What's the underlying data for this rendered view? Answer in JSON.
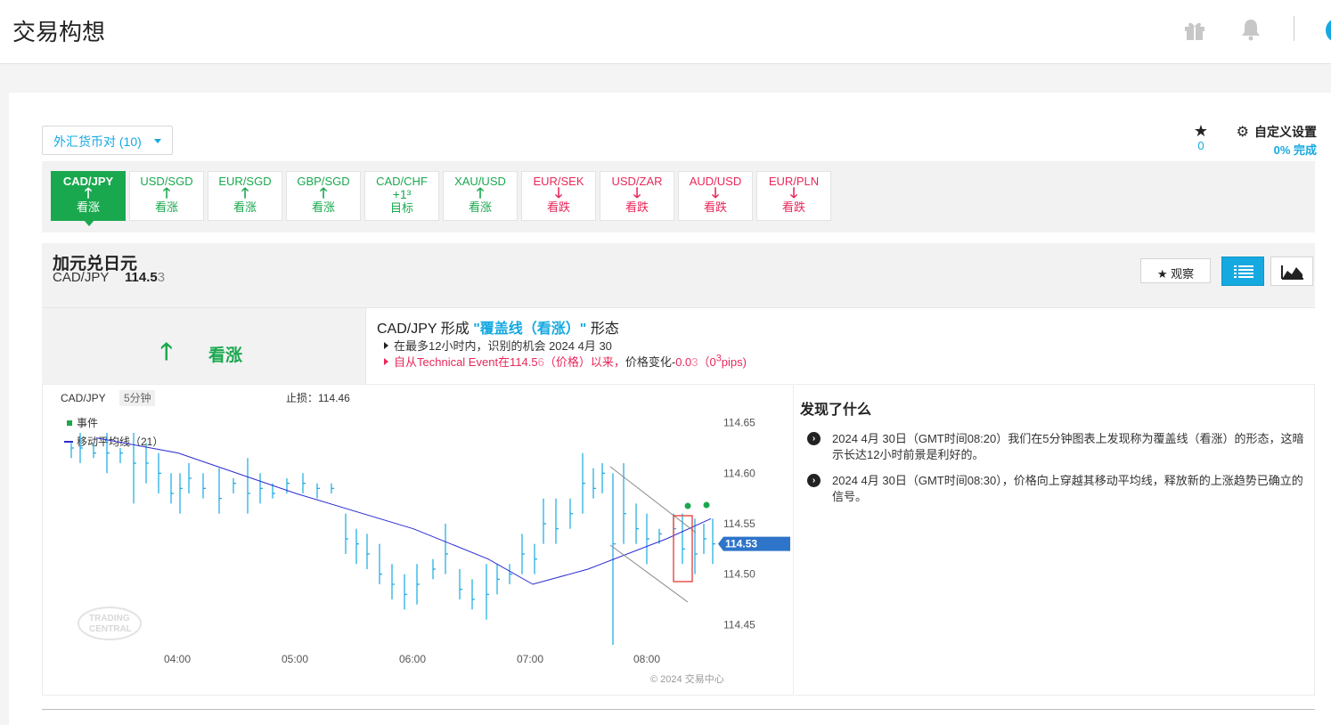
{
  "header": {
    "title": "交易构想"
  },
  "filter": {
    "dropdown_label": "外汇货币对 (10)"
  },
  "watchlist": {
    "count": "0"
  },
  "settings": {
    "label": "自定义设置",
    "progress": "0% 完成"
  },
  "tabs": [
    {
      "symbol": "CAD/JPY",
      "arrow": "🡑",
      "label": "看涨",
      "state": "active"
    },
    {
      "symbol": "USD/SGD",
      "arrow": "🡑",
      "label": "看涨",
      "state": "up"
    },
    {
      "symbol": "EUR/SGD",
      "arrow": "🡑",
      "label": "看涨",
      "state": "up"
    },
    {
      "symbol": "GBP/SGD",
      "arrow": "🡑",
      "label": "看涨",
      "state": "up"
    },
    {
      "symbol": "CAD/CHF",
      "arrow": "+1³",
      "label": "目标",
      "state": "neutral"
    },
    {
      "symbol": "XAU/USD",
      "arrow": "🡑",
      "label": "看涨",
      "state": "up"
    },
    {
      "symbol": "EUR/SEK",
      "arrow": "🡓",
      "label": "看跌",
      "state": "down"
    },
    {
      "symbol": "USD/ZAR",
      "arrow": "🡓",
      "label": "看跌",
      "state": "down"
    },
    {
      "symbol": "AUD/USD",
      "arrow": "🡓",
      "label": "看跌",
      "state": "down"
    },
    {
      "symbol": "EUR/PLN",
      "arrow": "🡓",
      "label": "看跌",
      "state": "down"
    }
  ],
  "instrument": {
    "name": "加元兑日元",
    "symbol": "CAD/JPY",
    "price_main": "114.5",
    "price_last": "3",
    "watch_button": "观察"
  },
  "verdict": {
    "label": "看涨"
  },
  "pattern": {
    "title_prefix": "CAD/JPY 形成 ",
    "title_highlight": "\"覆盖线（看涨）\"",
    "title_suffix": " 形态",
    "line1": "在最多12小时内，识别的机会 2024 4月 30",
    "line2_a": "自从Technical Event在114.5",
    "line2_b": "6",
    "line2_c": "（价格）以来，",
    "line2_d": "价格变化-",
    "line2_e": "0.0",
    "line2_f": "3",
    "line2_g": "（0",
    "line2_h": "3",
    "line2_i": "pips)"
  },
  "chart": {
    "symbol": "CAD/JPY",
    "timeframe": "5分钟",
    "stop_loss": "止损：114.46",
    "legend_event": "事件",
    "legend_ma": "移动平均线（21）",
    "price_tag": "114.53",
    "watermark_1": "TRADING",
    "watermark_2": "CENTRAL",
    "copyright": "© 2024 交易中心",
    "up_color": "#15a9e1",
    "ma_color": "#2b2bd1",
    "event_color": "#1aa84f"
  },
  "chart_data": {
    "type": "line",
    "x": [
      "04:00",
      "05:00",
      "06:00",
      "07:00",
      "08:00"
    ],
    "y_ticks": [
      114.65,
      114.6,
      114.55,
      114.5,
      114.45
    ],
    "ylim": [
      114.43,
      114.67
    ],
    "last_price": 114.53,
    "stop_loss": 114.46,
    "series": [
      {
        "name": "移动平均线（21）",
        "values": [
          114.635,
          114.62,
          114.58,
          114.545,
          114.515,
          114.49,
          114.505,
          114.535,
          114.555
        ]
      }
    ]
  },
  "findings": {
    "title": "发现了什么",
    "items": [
      "2024 4月 30日（GMT时间08:20）我们在5分钟图表上发现称为覆盖线（看涨）的形态，这暗示长达12小时前景是利好的。",
      "2024 4月 30日（GMT时间08:30），价格向上穿越其移动平均线，释放新的上涨趋势已确立的信号。"
    ]
  }
}
